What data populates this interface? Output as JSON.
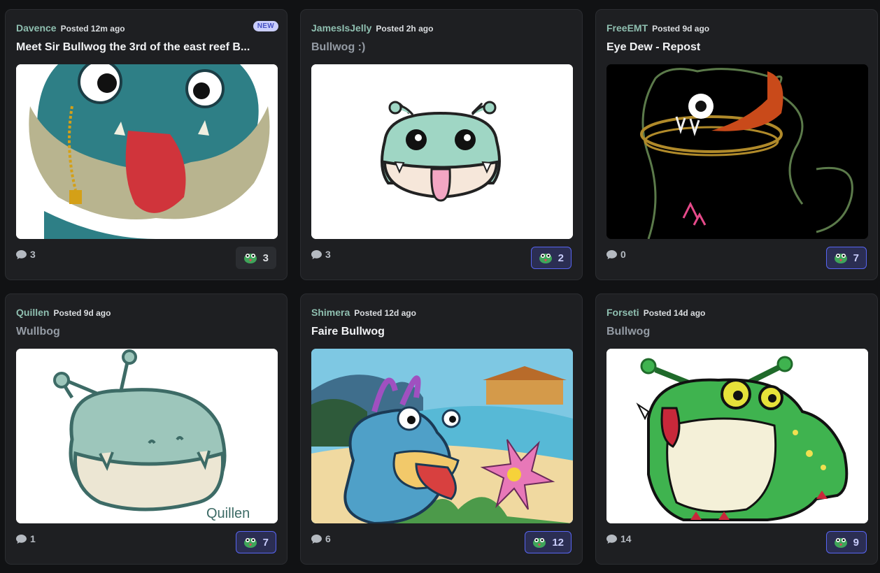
{
  "posts": [
    {
      "author": "Davence",
      "posted": "Posted 12m ago",
      "badge": "NEW",
      "title": "Meet Sir Bullwog the 3rd of the east reef B...",
      "title_muted": false,
      "comments": "3",
      "reactions": "3",
      "reacted": false,
      "image": "frog-face-tongue-illustration",
      "colors": {
        "bg": "#ffffff",
        "skin": "#2e7f86"
      }
    },
    {
      "author": "JamesIsJelly",
      "posted": "Posted 2h ago",
      "badge": "",
      "title": "Bullwog :)",
      "title_muted": true,
      "comments": "3",
      "reactions": "2",
      "reacted": true,
      "image": "cartoon-bullwog-head",
      "colors": {
        "bg": "#ffffff",
        "skin": "#9fd6c4"
      }
    },
    {
      "author": "FreeEMT",
      "posted": "Posted 9d ago",
      "badge": "",
      "title": "Eye Dew - Repost",
      "title_muted": false,
      "comments": "0",
      "reactions": "7",
      "reacted": true,
      "image": "neon-sketch-bullwog",
      "colors": {
        "bg": "#000000",
        "skin": "#5b7a4a"
      }
    },
    {
      "author": "Quillen",
      "posted": "Posted 9d ago",
      "badge": "",
      "title": "Wullbog",
      "title_muted": true,
      "comments": "1",
      "reactions": "7",
      "reacted": true,
      "image": "doodle-bullwog",
      "colors": {
        "bg": "#ffffff",
        "skin": "#9dc6bb"
      },
      "signature": "Quillen"
    },
    {
      "author": "Shimera",
      "posted": "Posted 12d ago",
      "badge": "",
      "title": "Faire Bullwog",
      "title_muted": false,
      "comments": "6",
      "reactions": "12",
      "reacted": true,
      "image": "bullwog-beach-scene",
      "colors": {
        "bg": "#7ec8e3",
        "skin": "#4fa0c8"
      }
    },
    {
      "author": "Forseti",
      "posted": "Posted 14d ago",
      "badge": "",
      "title": "Bullwog",
      "title_muted": true,
      "comments": "14",
      "reactions": "9",
      "reacted": true,
      "image": "pixel-green-bullwog",
      "colors": {
        "bg": "#ffffff",
        "skin": "#3fb34f"
      }
    }
  ],
  "icons": {
    "comment": "speech-bubble-icon",
    "reaction": "bullwog-emoji-icon"
  }
}
